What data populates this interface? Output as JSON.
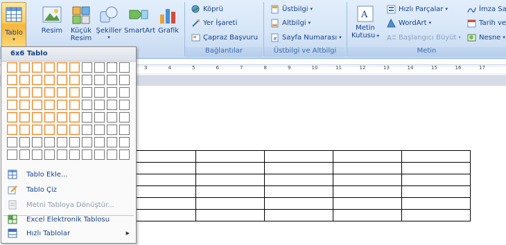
{
  "ribbon": {
    "tablolar": {
      "tablo": "Tablo"
    },
    "cizimler": {
      "resim": "Resim",
      "kucuk_resim_1": "Küçük",
      "kucuk_resim_2": "Resim",
      "sekiller": "Şekiller",
      "smartart": "SmartArt",
      "grafik": "Grafik"
    },
    "baglantilar": {
      "label": "Bağlantılar",
      "kopru": "Köprü",
      "yer_isareti": "Yer İşareti",
      "capraz_basvuru": "Çapraz Başvuru"
    },
    "ustbilgi_altbilgi": {
      "label": "Üstbilgi ve Altbilgi",
      "ustbilgi": "Üstbilgi",
      "altbilgi": "Altbilgi",
      "sayfa_numarasi": "Sayfa Numarası"
    },
    "metin": {
      "label": "Metin",
      "metin_kutusu_1": "Metin",
      "metin_kutusu_2": "Kutusu",
      "hizli_parcalar": "Hızlı Parçalar",
      "wordart": "WordArt",
      "baslangici_buyut": "Başlangıcı Büyüt",
      "imza_satiri": "İmza Sat",
      "tarih_ve_saat": "Tarih ve",
      "nesne": "Nesne"
    }
  },
  "ruler": {
    "ticks": [
      "3",
      "4",
      "5",
      "6",
      "7",
      "8",
      "9",
      "10",
      "11",
      "12",
      "13",
      "14",
      "15",
      "16",
      "17"
    ]
  },
  "dropdown": {
    "title": "6x6 Tablo",
    "grid": {
      "cols": 10,
      "rows": 8,
      "selected_cols": 6,
      "selected_rows": 6
    },
    "items": {
      "tablo_ekle": "Tablo Ekle...",
      "tablo_ciz": "Tablo Çiz",
      "metni_tabloya": "Metni Tabloya Dönüştür...",
      "excel": "Excel Elektronik Tablosu",
      "hizli_tablolar": "Hızlı Tablolar"
    }
  },
  "document": {
    "table": {
      "rows": 6,
      "cols": 5
    }
  },
  "colors": {
    "ribbon_text": "#15428b",
    "grid_selected": "#ef8b2b",
    "tablo_button": "#fbce5e"
  }
}
